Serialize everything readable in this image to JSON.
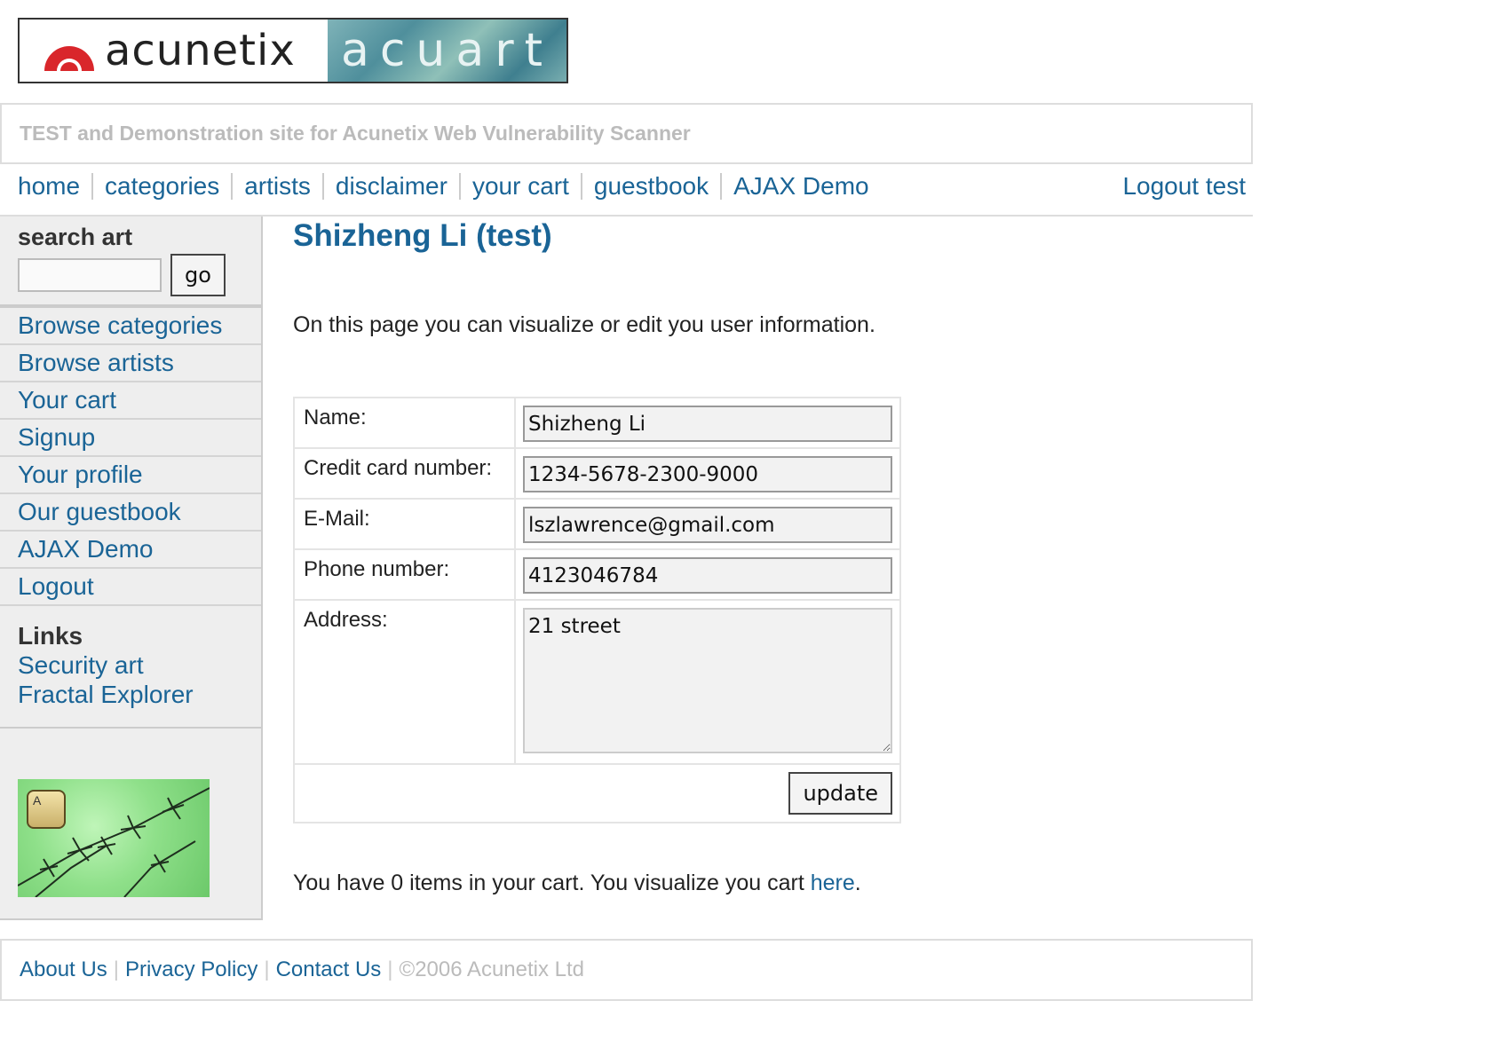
{
  "logo": {
    "brand": "acunetix",
    "product": "acuart"
  },
  "header": {
    "tagline": "TEST and Demonstration site for Acunetix Web Vulnerability Scanner"
  },
  "topnav": {
    "items": [
      "home",
      "categories",
      "artists",
      "disclaimer",
      "your cart",
      "guestbook",
      "AJAX Demo"
    ],
    "logout": "Logout test"
  },
  "sidebar": {
    "search_title": "search art",
    "search_placeholder": "",
    "go_label": "go",
    "items": [
      "Browse categories",
      "Browse artists",
      "Your cart",
      "Signup",
      "Your profile",
      "Our guestbook",
      "AJAX Demo",
      "Logout"
    ],
    "links_title": "Links",
    "links": [
      "Security art",
      "Fractal Explorer"
    ],
    "badge_letter": "A"
  },
  "main": {
    "title": "Shizheng Li (test)",
    "intro": "On this page you can visualize or edit you user information.",
    "form": {
      "name_label": "Name:",
      "name_value": "Shizheng Li",
      "cc_label": "Credit card number:",
      "cc_value": "1234-5678-2300-9000",
      "email_label": "E-Mail:",
      "email_value": "lszlawrence@gmail.com",
      "phone_label": "Phone number:",
      "phone_value": "4123046784",
      "address_label": "Address:",
      "address_value": "21 street",
      "update_label": "update"
    },
    "cart_text_before": "You have 0 items in your cart. You visualize you cart ",
    "cart_link": "here",
    "cart_text_after": "."
  },
  "footer": {
    "about": "About Us",
    "privacy": "Privacy Policy",
    "contact": "Contact Us",
    "copyright": "©2006 Acunetix Ltd",
    "separator": "|"
  },
  "colors": {
    "link": "#1a6496",
    "tagline": "#bbbbbb",
    "sidebar_bg": "#eeeeee"
  }
}
